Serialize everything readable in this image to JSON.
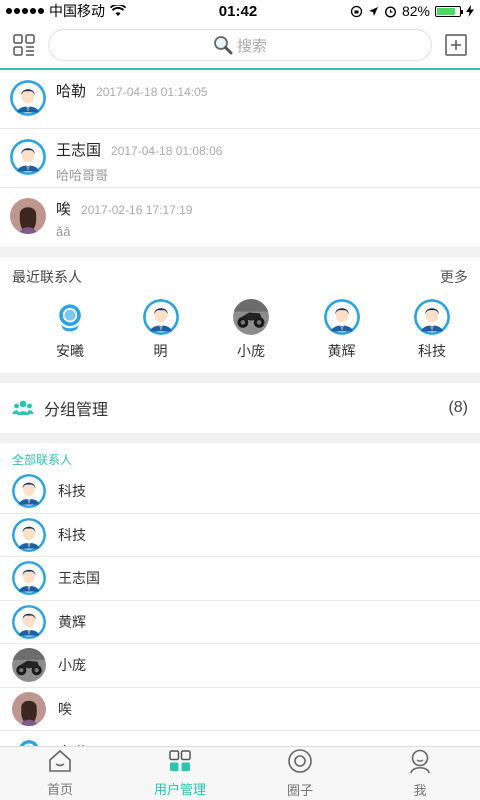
{
  "status": {
    "carrier": "中国移动",
    "time": "01:42",
    "battery": "82%"
  },
  "search": {
    "placeholder": "搜索"
  },
  "conversations": [
    {
      "name": "哈勒",
      "time": "2017-04-18 01:14:05",
      "message": "",
      "avatar": "blue"
    },
    {
      "name": "王志国",
      "time": "2017-04-18 01:08:06",
      "message": "哈哈哥哥",
      "avatar": "blue"
    },
    {
      "name": "唉",
      "time": "2017-02-16 17:17:19",
      "message": "ǎǎ",
      "avatar": "photo-girl"
    }
  ],
  "recent": {
    "title": "最近联系人",
    "more": "更多",
    "contacts": [
      {
        "name": "安曦",
        "avatar": "badge"
      },
      {
        "name": "明",
        "avatar": "blue"
      },
      {
        "name": "小庞",
        "avatar": "photo-moto"
      },
      {
        "name": "黄辉",
        "avatar": "blue"
      },
      {
        "name": "科技",
        "avatar": "blue"
      }
    ]
  },
  "group": {
    "label": "分组管理",
    "count": "(8)"
  },
  "all_contacts": {
    "title": "全部联系人",
    "items": [
      {
        "name": "科技",
        "avatar": "blue"
      },
      {
        "name": "科技",
        "avatar": "blue"
      },
      {
        "name": "王志国",
        "avatar": "blue"
      },
      {
        "name": "黄辉",
        "avatar": "blue"
      },
      {
        "name": "小庞",
        "avatar": "photo-moto"
      },
      {
        "name": "唉",
        "avatar": "photo-girl"
      },
      {
        "name": "安曦",
        "avatar": "badge"
      }
    ]
  },
  "tabs": [
    {
      "label": "首页",
      "icon": "home-icon",
      "active": false
    },
    {
      "label": "用户管理",
      "icon": "grid-icon",
      "active": true
    },
    {
      "label": "圈子",
      "icon": "circle-icon",
      "active": false
    },
    {
      "label": "我",
      "icon": "person-icon",
      "active": false
    }
  ],
  "colors": {
    "accent": "#2cc3b0",
    "avatar_blue": "#2aa3e0"
  }
}
